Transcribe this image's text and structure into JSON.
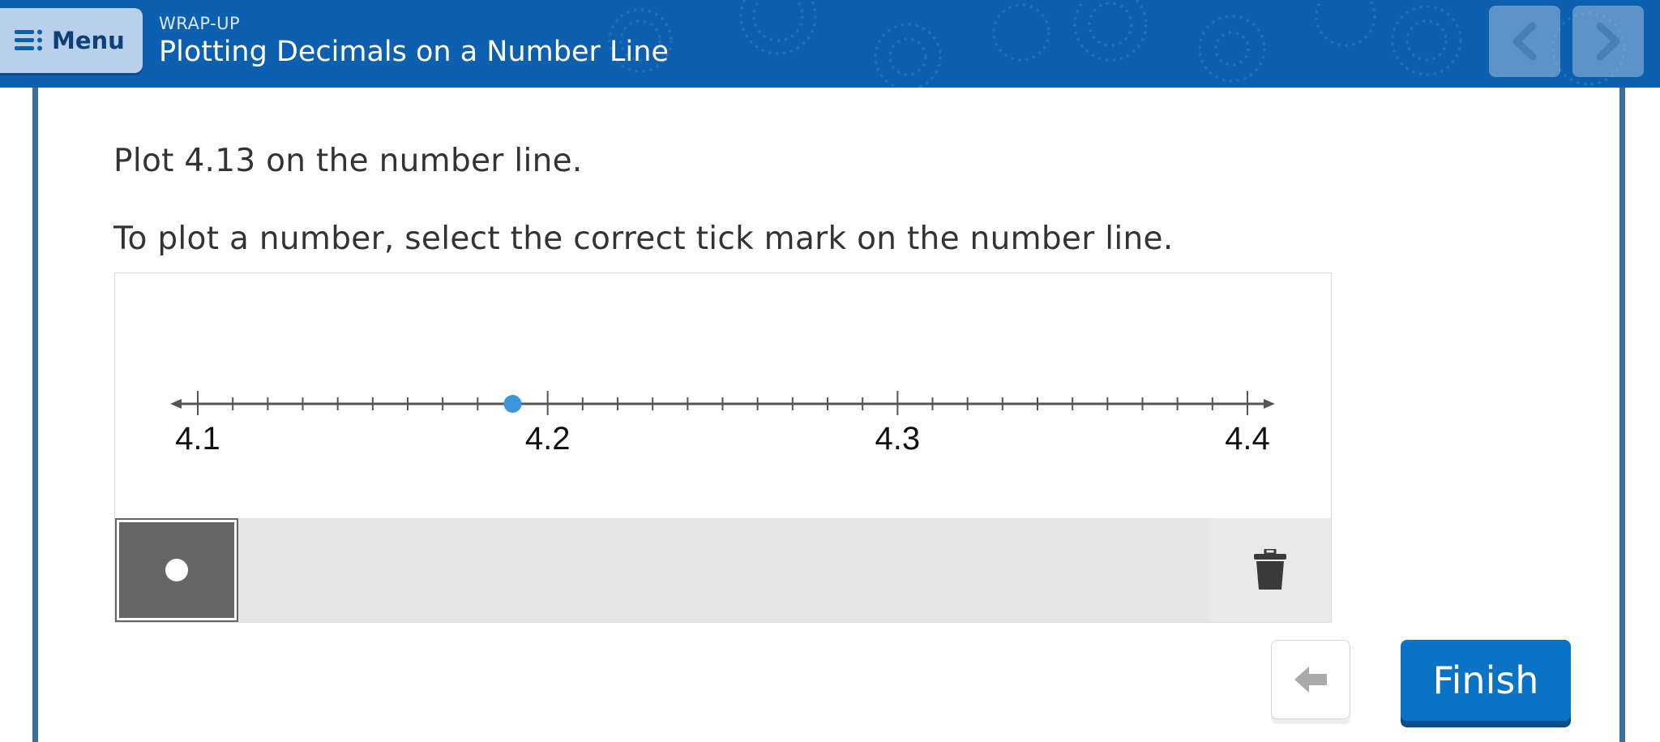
{
  "header": {
    "menu_label": "Menu",
    "section_label": "WRAP-UP",
    "title": "Plotting Decimals on a Number Line",
    "bg_color": "#0d5fb0"
  },
  "nav": {
    "prev_icon": "chevron-left-icon",
    "next_icon": "chevron-right-icon"
  },
  "main": {
    "prompt1": "Plot 4.13 on the number line.",
    "prompt2": "To plot a number, select the correct tick mark on the number line."
  },
  "number_line": {
    "min": 4.1,
    "max": 4.4,
    "step": 0.01,
    "major_step": 0.1,
    "labels": [
      "4.1",
      "4.2",
      "4.3",
      "4.4"
    ],
    "plotted_point": 4.19,
    "point_color": "#3a96dd",
    "line_color": "#555555"
  },
  "toolbar": {
    "point_tool": "point-tool",
    "trash_icon": "trash-icon"
  },
  "footer": {
    "back_icon": "back-arrow-icon",
    "finish_label": "Finish",
    "finish_color": "#0b73c6"
  }
}
